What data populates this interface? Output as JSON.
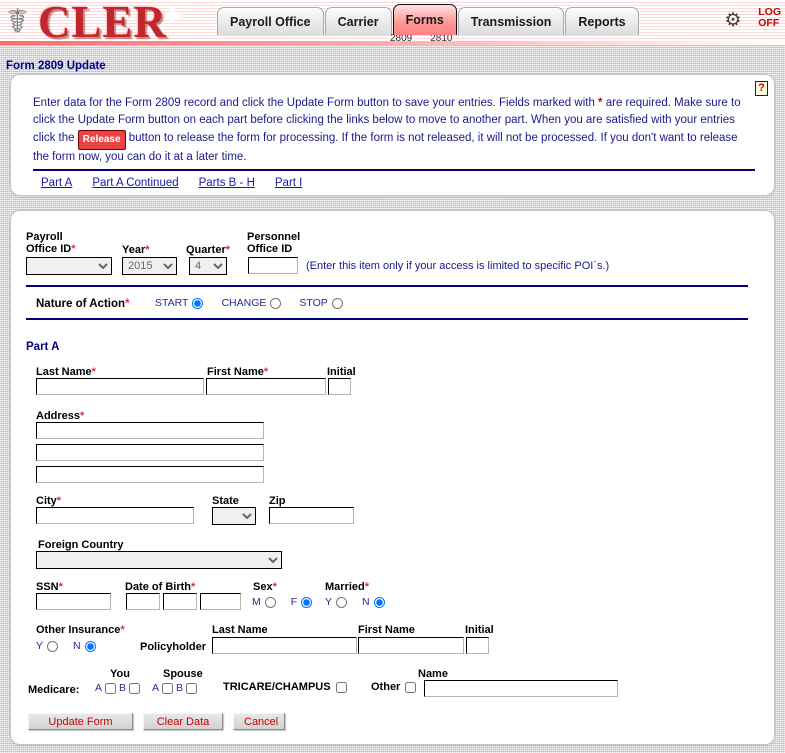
{
  "banner": {
    "logo_text": "CLER",
    "caduceus_icon": "caduceus-icon",
    "gear_icon": "gear-icon",
    "logoff_line1": "LOG",
    "logoff_line2": "OFF",
    "tabs": [
      {
        "label": "Payroll Office",
        "active": false
      },
      {
        "label": "Carrier",
        "active": false
      },
      {
        "label": "Forms",
        "active": true
      },
      {
        "label": "Transmission",
        "active": false
      },
      {
        "label": "Reports",
        "active": false
      }
    ],
    "subtabs": [
      "2809",
      "2810"
    ]
  },
  "page": {
    "title": "Form 2809 Update",
    "help_icon_label": "?"
  },
  "instructions": {
    "part1": "Enter data for the Form 2809 record and click the Update Form button to save your entries.  Fields marked with ",
    "asterisk": "*",
    "part2": " are required.  Make sure to click the Update Form button on each part before clicking the links below to move to another part.  When you are satisfied with your entries click the ",
    "release_button": "Release",
    "part3": " button to release the form for processing.  If the form is not released, it will not be processed.  If you don't want to release the form now, you can do it at a later time.",
    "part_links": [
      "Part A",
      "Part A Continued",
      "Parts B - H",
      "Part I"
    ]
  },
  "header_fields": {
    "payroll_office_id_label_line1": "Payroll",
    "payroll_office_id_label_line2": "Office ID",
    "payroll_office_id_value": "",
    "year_label": "Year",
    "year_value": "2015",
    "quarter_label": "Quarter",
    "quarter_value": "4",
    "personnel_office_id_label_line1": "Personnel",
    "personnel_office_id_label_line2": "Office ID",
    "personnel_office_id_value": "",
    "poi_note": "(Enter this item only if your access is limited to specific POI´s.)"
  },
  "nature_of_action": {
    "label": "Nature of Action",
    "options": [
      {
        "label": "START",
        "selected": true
      },
      {
        "label": "CHANGE",
        "selected": false
      },
      {
        "label": "STOP",
        "selected": false
      }
    ]
  },
  "part_a": {
    "section_title": "Part A",
    "last_name_label": "Last Name",
    "last_name_value": "",
    "first_name_label": "First Name",
    "first_name_value": "",
    "initial_label": "Initial",
    "initial_value": "",
    "address_label": "Address",
    "address_line1": "",
    "address_line2": "",
    "address_line3": "",
    "city_label": "City",
    "city_value": "",
    "state_label": "State",
    "state_value": "",
    "zip_label": "Zip",
    "zip_value": "",
    "foreign_country_label": "Foreign Country",
    "foreign_country_value": "",
    "ssn_label": "SSN",
    "ssn_value": "",
    "dob_label": "Date of Birth",
    "dob_month": "",
    "dob_day": "",
    "dob_year": "",
    "sex_label": "Sex",
    "sex_options": [
      {
        "label": "M",
        "selected": false
      },
      {
        "label": "F",
        "selected": true
      }
    ],
    "married_label": "Married",
    "married_options": [
      {
        "label": "Y",
        "selected": false
      },
      {
        "label": "N",
        "selected": true
      }
    ],
    "other_insurance_label": "Other Insurance",
    "other_insurance_options": [
      {
        "label": "Y",
        "selected": false
      },
      {
        "label": "N",
        "selected": true
      }
    ],
    "policyholder_label": "Policyholder",
    "ph_last_name_label": "Last Name",
    "ph_last_name_value": "",
    "ph_first_name_label": "First Name",
    "ph_first_name_value": "",
    "ph_initial_label": "Initial",
    "ph_initial_value": "",
    "medicare_label": "Medicare:",
    "you_label": "You",
    "spouse_label": "Spouse",
    "you_a_label": "A",
    "you_a_checked": false,
    "you_b_label": "B",
    "you_b_checked": false,
    "spouse_a_label": "A",
    "spouse_a_checked": false,
    "spouse_b_label": "B",
    "spouse_b_checked": false,
    "tricare_label": "TRICARE/CHAMPUS",
    "tricare_checked": false,
    "other_label": "Other",
    "other_checked": false,
    "other_name_label": "Name",
    "other_name_value": ""
  },
  "buttons": {
    "update": "Update Form",
    "clear": "Clear Data",
    "cancel": "Cancel"
  },
  "colors": {
    "brand_red": "#c0272d",
    "navy": "#000080",
    "required_star": "#e03030",
    "link_blue": "#1818a8",
    "button_text": "#cc0000"
  }
}
